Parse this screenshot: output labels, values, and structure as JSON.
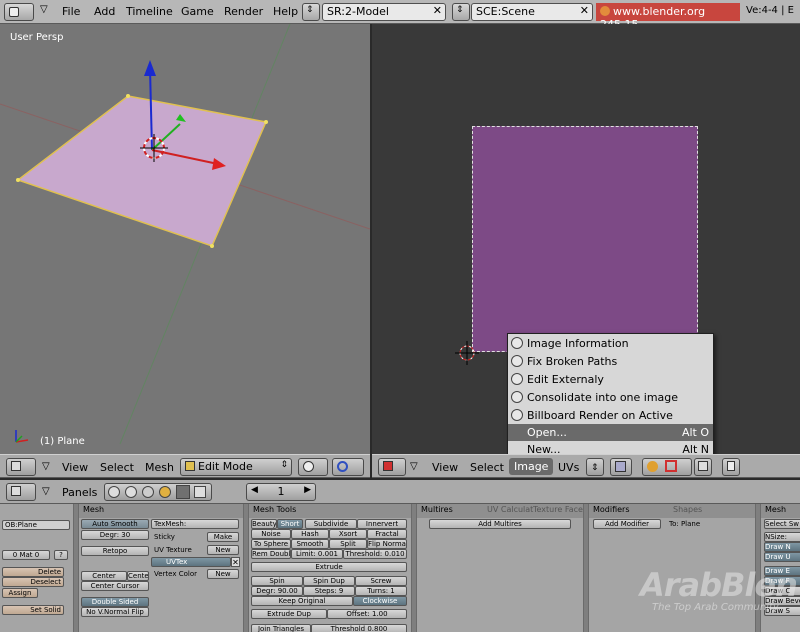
{
  "top_menu": {
    "items": [
      "File",
      "Add",
      "Timeline",
      "Game",
      "Render",
      "Help"
    ],
    "screen_field": "SR:2-Model",
    "scene_field": "SCE:Scene",
    "url_badge": "www.blender.org 245.15",
    "stats": "Ve:4-4 | E"
  },
  "viewport3d": {
    "label": "User Persp",
    "object_label": "(1) Plane",
    "header": {
      "view": "View",
      "select": "Select",
      "mesh": "Mesh",
      "mode": "Edit Mode"
    }
  },
  "image_editor": {
    "header": {
      "view": "View",
      "select": "Select",
      "image": "Image",
      "uvs": "UVs"
    },
    "menu": [
      {
        "label": "Image Information",
        "shortcut": ""
      },
      {
        "label": "Fix Broken Paths",
        "shortcut": ""
      },
      {
        "label": "Edit Externaly",
        "shortcut": ""
      },
      {
        "label": "Consolidate into one image",
        "shortcut": ""
      },
      {
        "label": "Billboard Render on Active",
        "shortcut": ""
      },
      {
        "label": "Open...",
        "shortcut": "Alt O"
      },
      {
        "label": "New...",
        "shortcut": "Alt N"
      }
    ]
  },
  "buttons_header": {
    "panels": "Panels",
    "frame": "1"
  },
  "panels": {
    "link": {
      "ob": "OB:Plane",
      "mat": "0 Mat 0",
      "mat_q": "?",
      "delete": "Delete",
      "deselect": "Deselect",
      "assign": "Assign",
      "set_solid": "Set Solid"
    },
    "mesh": {
      "title": "Mesh",
      "auto_smooth": "Auto Smooth",
      "degr": "Degr: 30",
      "retopo": "Retopo",
      "center_new": "Center New",
      "center": "Center",
      "center_cursor": "Center Cursor",
      "double_sided": "Double Sided",
      "no_vnormal_flip": "No V.Normal Flip",
      "texmesh": "TexMesh:",
      "sticky": "Sticky",
      "make": "Make",
      "uv_texture": "UV Texture",
      "new": "New",
      "uvtex": "UVTex",
      "vertex_color": "Vertex Color",
      "new2": "New"
    },
    "mesh_tools": {
      "title": "Mesh Tools",
      "row1": [
        "Beauty",
        "Short",
        "Subdivide",
        "Innervert"
      ],
      "row2": [
        "Noise",
        "Hash",
        "Xsort",
        "Fractal"
      ],
      "row3": [
        "To Sphere",
        "Smooth",
        "Split",
        "Flip Normal"
      ],
      "row4": [
        "Rem Doubl",
        "Limit: 0.001",
        "Threshold: 0.010"
      ],
      "extrude": "Extrude",
      "row6": [
        "Spin",
        "Spin Dup",
        "Screw"
      ],
      "row7": [
        "Degr: 90.00",
        "Steps: 9",
        "Turns: 1"
      ],
      "keep_original": "Keep Original",
      "clockwise": "Clockwise",
      "extrude_dup": "Extrude Dup",
      "offset": "Offset: 1.00",
      "join_triangles": "Join Triangles",
      "threshold": "Threshold 0.800"
    },
    "multires": {
      "title": "Multires",
      "tab2": "UV Calculat",
      "tab3": "Texture Face",
      "add": "Add Multires"
    },
    "modifiers": {
      "title": "Modifiers",
      "tab2": "Shapes",
      "add": "Add Modifier",
      "to": "To: Plane"
    },
    "mesh_right": {
      "title": "Mesh",
      "select_sw": "Select Sw",
      "nsize": "NSize:",
      "draw_n": "Draw N",
      "draw_u": "Draw U",
      "draw_e": "Draw E",
      "draw_f": "Draw F",
      "draw_c": "Draw C",
      "draw_beve": "Draw Beve",
      "draw_s": "Draw S"
    }
  },
  "watermark": {
    "main": "ArabBlen",
    "sub": "The Top Arab Community"
  },
  "colors": {
    "face": "#c8a8cd",
    "image_purple": "#7d4a86",
    "header": "#aaaaaa",
    "viewport_bg": "#767676"
  }
}
